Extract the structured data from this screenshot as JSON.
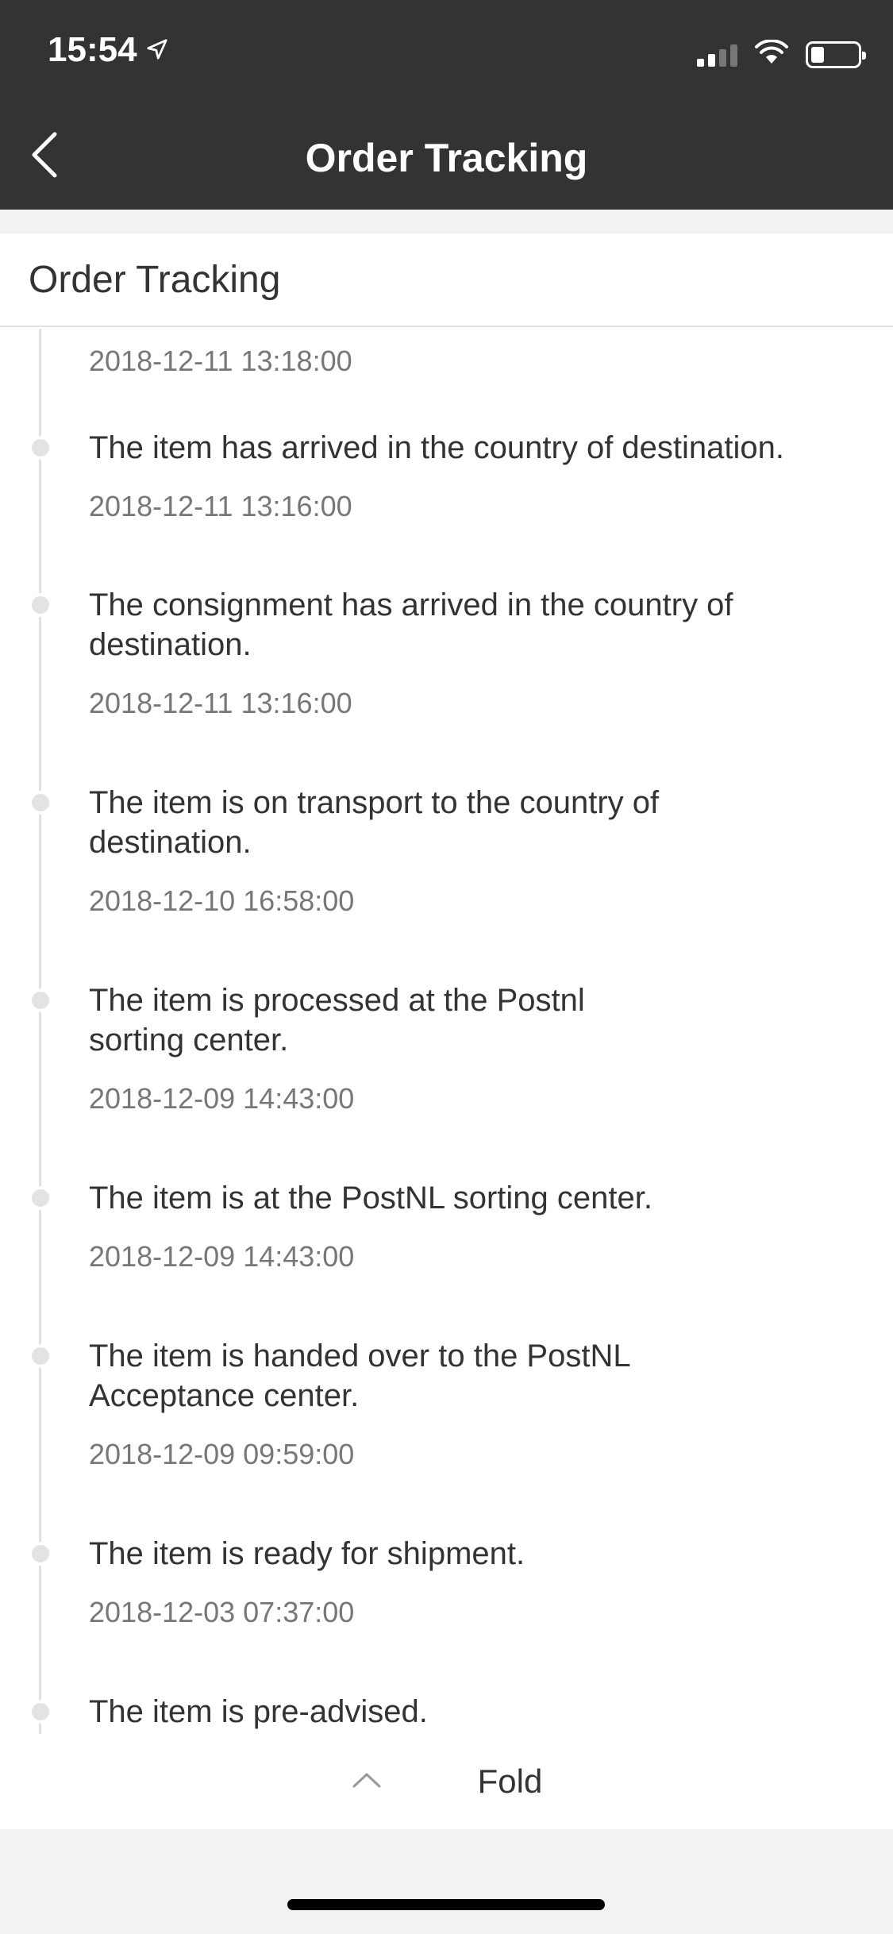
{
  "status_bar": {
    "time": "15:54",
    "icons": [
      "location-arrow-icon",
      "cellular-signal-icon",
      "wifi-icon",
      "battery-icon"
    ]
  },
  "nav": {
    "back_icon": "chevron-left-icon",
    "title": "Order Tracking"
  },
  "card": {
    "header": "Order Tracking",
    "top_time": "2018-12-11 13:18:00",
    "events": [
      {
        "text": "The item has arrived in the country of destination.",
        "time": "2018-12-11 13:16:00"
      },
      {
        "text": "The consignment has arrived in the country of destination.",
        "time": "2018-12-11 13:16:00"
      },
      {
        "text": "The item is on transport to the country of destination.",
        "time": "2018-12-10 16:58:00"
      },
      {
        "text": "The item is processed at the Postnl sorting center.",
        "time": "2018-12-09 14:43:00"
      },
      {
        "text": "The item is at the PostNL sorting center.",
        "time": "2018-12-09 14:43:00"
      },
      {
        "text": "The item is handed over to the PostNL Acceptance center.",
        "time": "2018-12-09 09:59:00"
      },
      {
        "text": "The item is ready for shipment.",
        "time": "2018-12-03 07:37:00"
      },
      {
        "text": "The item is pre-advised.",
        "time": ""
      }
    ],
    "fold_label": "Fold",
    "fold_icon": "chevron-up-icon"
  }
}
